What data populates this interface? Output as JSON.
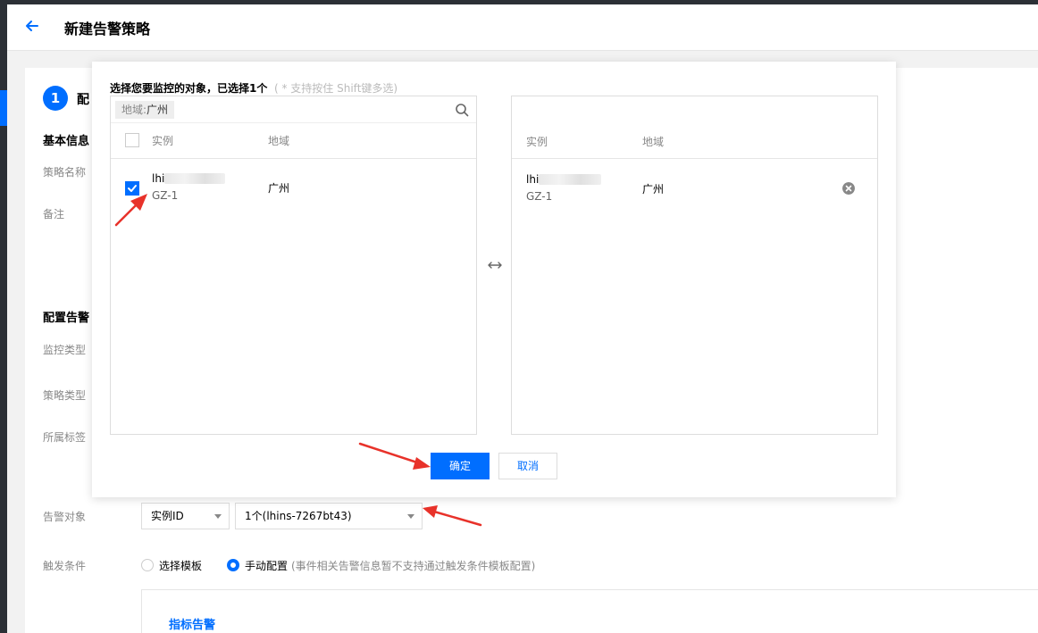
{
  "header": {
    "title": "新建告警策略"
  },
  "form": {
    "step_number": "1",
    "step_label": "配",
    "basic_section": "基本信息",
    "policy_name_label": "策略名称",
    "remark_label": "备注",
    "alarm_section": "配置告警",
    "monitor_type_label": "监控类型",
    "policy_type_label": "策略类型",
    "tag_label": "所属标签",
    "alarm_object_label": "告警对象",
    "object_type_select": "实例ID",
    "object_value_select": "1个(lhins-7267bt43)",
    "trigger_label": "触发条件",
    "trigger_options": [
      {
        "label": "选择模板",
        "selected": false
      },
      {
        "label": "手动配置",
        "selected": true,
        "note": "(事件相关告警信息暂不支持通过触发条件模板配置)"
      }
    ],
    "metric_alarm_title": "指标告警"
  },
  "dialog": {
    "title": "选择您要监控的对象，已选择1个",
    "hint": "( * 支持按住 Shift键多选)",
    "left_panel": {
      "filter_key": "地域:",
      "filter_value": "广州",
      "columns": [
        "实例",
        "地域"
      ],
      "rows": [
        {
          "name": "lhi",
          "sub": "GZ-1",
          "region": "广州",
          "checked": true
        }
      ]
    },
    "right_panel": {
      "columns": [
        "实例",
        "地域"
      ],
      "rows": [
        {
          "name": "lhi",
          "sub": "GZ-1",
          "region": "广州"
        }
      ]
    },
    "confirm_label": "确定",
    "cancel_label": "取消"
  },
  "colors": {
    "primary": "#006eff",
    "annotation_arrow": "#e8322a"
  }
}
